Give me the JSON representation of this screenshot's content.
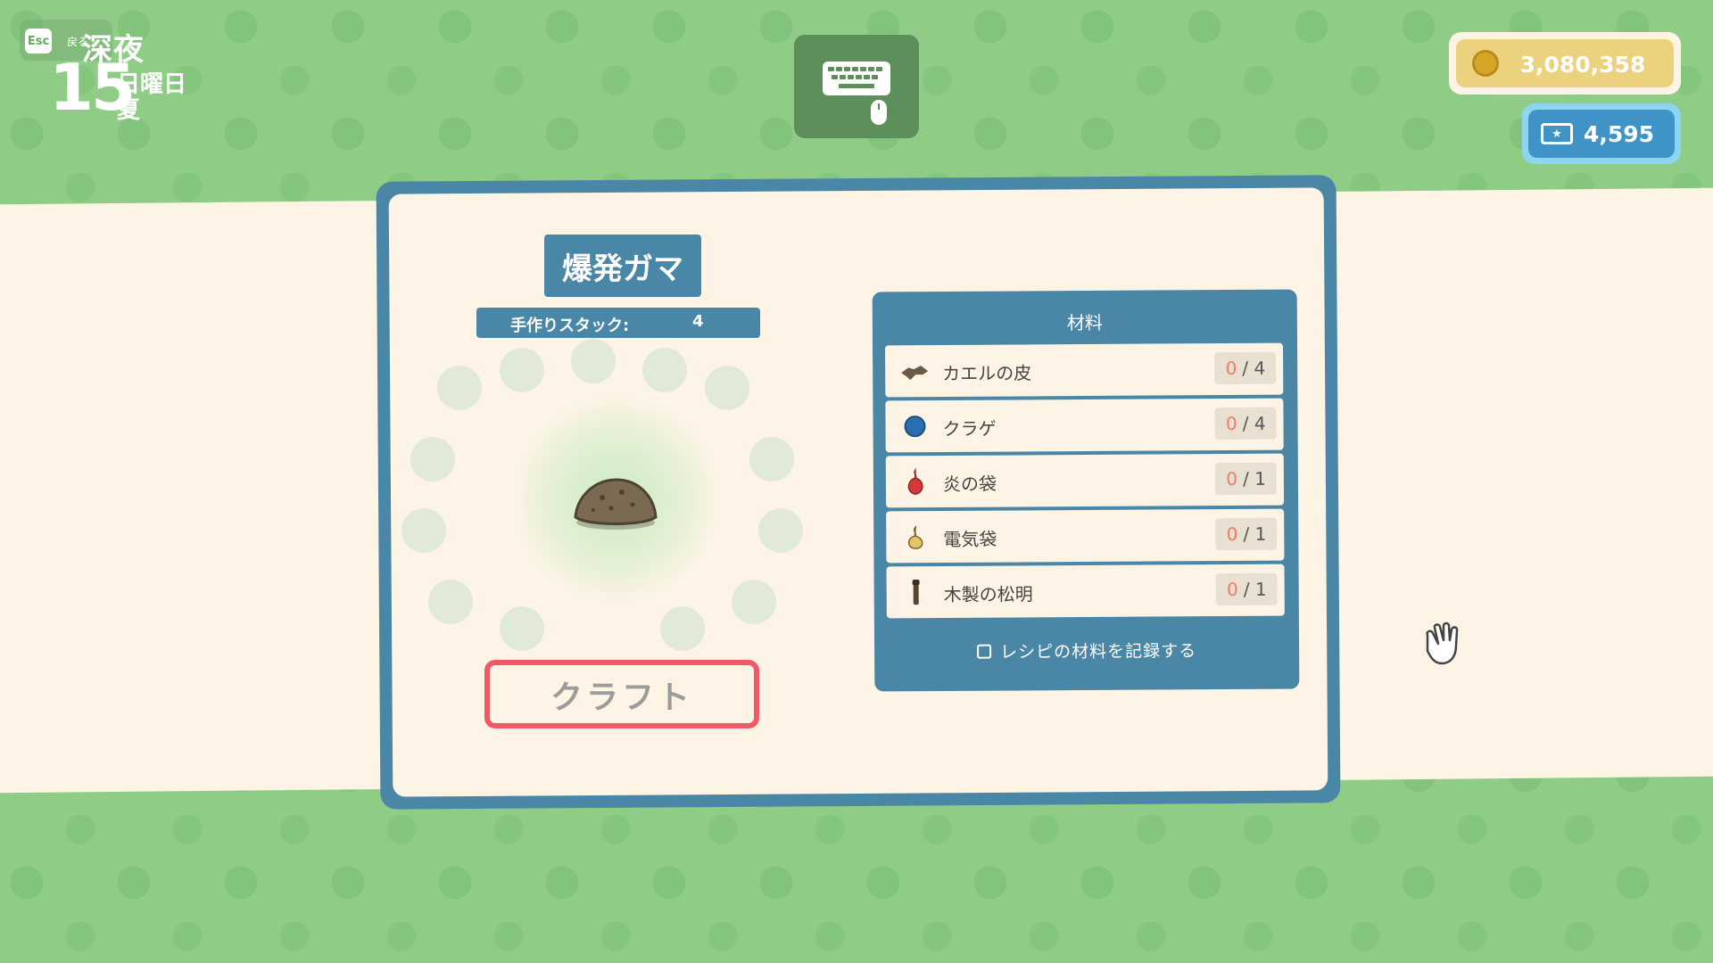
{
  "status": {
    "esc_key": "Esc",
    "back_label": "戻る",
    "time_of_day": "深夜",
    "day": "15",
    "weekday": "日曜日",
    "season": "夏"
  },
  "currency": {
    "gold": "3,080,358",
    "tickets": "4,595"
  },
  "item": {
    "name": "爆発ガマ",
    "stack_label": "手作りスタック:",
    "stack_value": "4"
  },
  "craft_button": "クラフト",
  "materials": {
    "title": "材料",
    "rows": [
      {
        "name": "カエルの皮",
        "have": "0",
        "sep": "/",
        "need": "4",
        "icon": "frog-skin-icon",
        "color": "#6b5a48"
      },
      {
        "name": "クラゲ",
        "have": "0",
        "sep": "/",
        "need": "4",
        "icon": "jellyfish-icon",
        "color": "#2a6fb0"
      },
      {
        "name": "炎の袋",
        "have": "0",
        "sep": "/",
        "need": "1",
        "icon": "fire-sac-icon",
        "color": "#d23a3a"
      },
      {
        "name": "電気袋",
        "have": "0",
        "sep": "/",
        "need": "1",
        "icon": "electric-sac-icon",
        "color": "#e3c56a"
      },
      {
        "name": "木製の松明",
        "have": "0",
        "sep": "/",
        "need": "1",
        "icon": "wooden-torch-icon",
        "color": "#5a4330"
      }
    ],
    "record_label": "レシピの材料を記録する"
  },
  "colors": {
    "background": "#8fcc85",
    "panel": "#4a87a7",
    "cream": "#fdf4e5",
    "craft_border": "#ef5a66",
    "gold": "#ecd27e",
    "ticket": "#3f93c7"
  }
}
